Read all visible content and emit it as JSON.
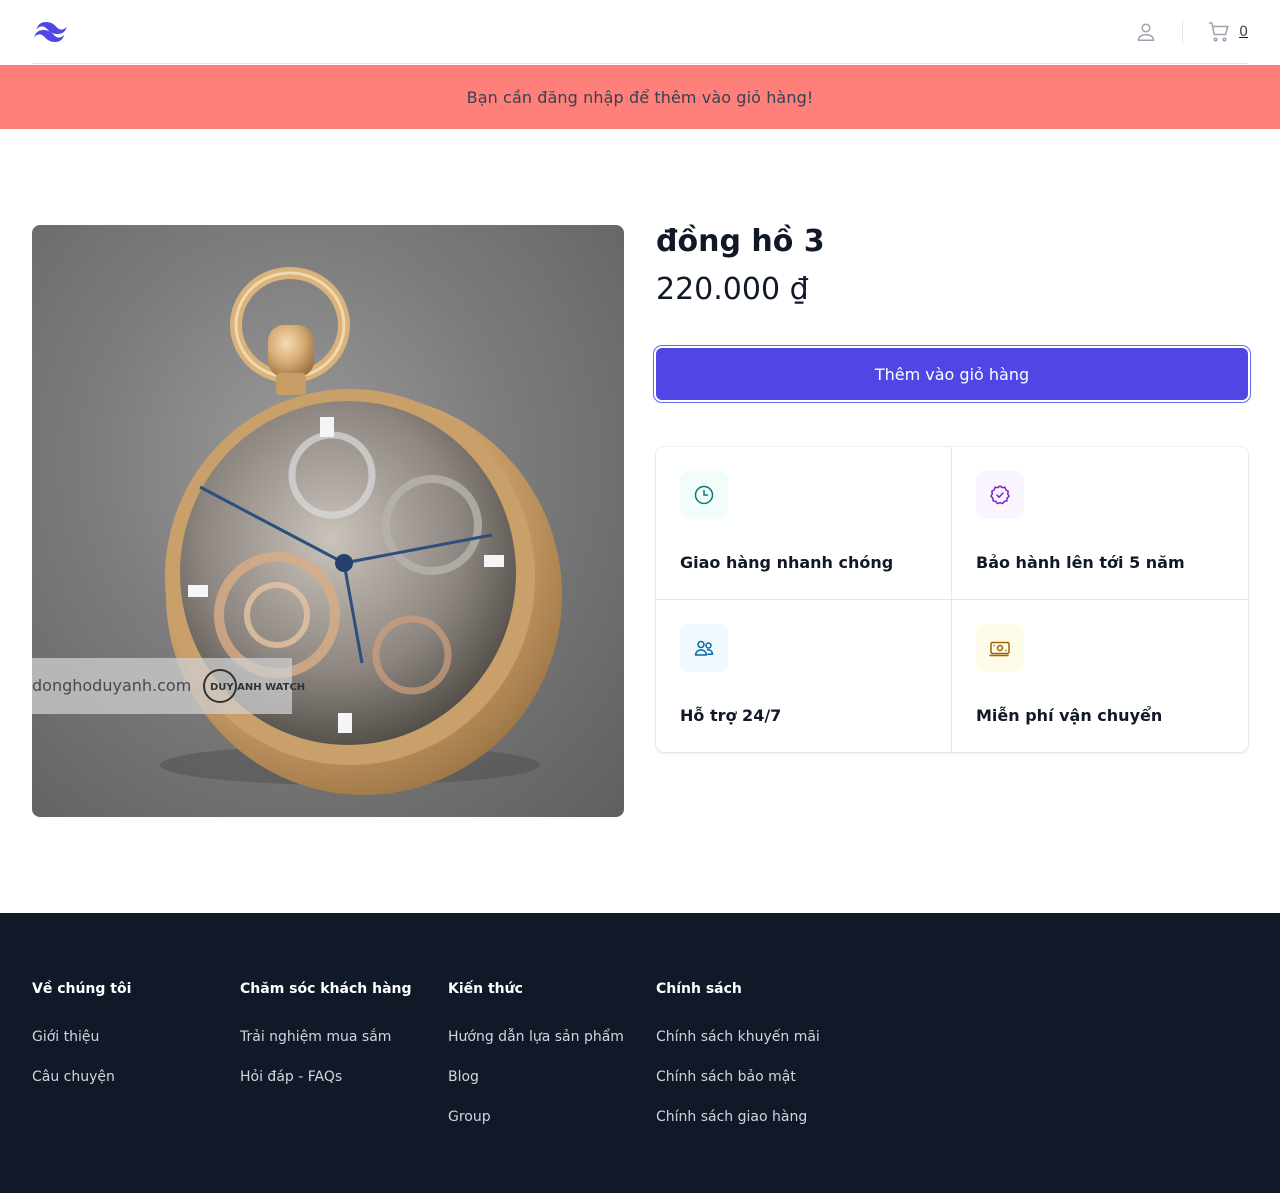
{
  "header": {
    "logo": "tailwind-logo",
    "user_icon": "user-icon",
    "cart_icon": "shopping-cart-icon",
    "cart_count": "0"
  },
  "alert": {
    "message": "Bạn cần đăng nhập để thêm vào giỏ hàng!",
    "color": "#ff807a"
  },
  "product": {
    "name": "đồng hồ 3",
    "price": "220.000 ₫",
    "add_to_cart_label": "Thêm vào giỏ hàng",
    "image_alt": "pocket-watch-image",
    "watermark_text": "donghoduyanh.com",
    "watermark_logo": "DUY ANH WATCH"
  },
  "features": [
    {
      "icon": "clock-icon",
      "label": "Giao hàng nhanh chóng",
      "accent": "#0f766e",
      "bg": "#f0fdfa"
    },
    {
      "icon": "badge-check-icon",
      "label": "Bảo hành lên tới 5 năm",
      "accent": "#7e22ce",
      "bg": "#faf5ff"
    },
    {
      "icon": "users-icon",
      "label": "Hỗ trợ 24/7",
      "accent": "#0369a1",
      "bg": "#f0f9ff"
    },
    {
      "icon": "cash-icon",
      "label": "Miễn phí vận chuyển",
      "accent": "#a16207",
      "bg": "#fefce8"
    }
  ],
  "footer": {
    "columns": [
      {
        "heading": "Về chúng tôi",
        "links": [
          "Giới thiệu",
          "Câu chuyện"
        ]
      },
      {
        "heading": "Chăm sóc khách hàng",
        "links": [
          "Trải nghiệm mua sắm",
          "Hỏi đáp - FAQs"
        ]
      },
      {
        "heading": "Kiến thức",
        "links": [
          "Hướng dẫn lựa sản phẩm",
          "Blog",
          "Group"
        ]
      },
      {
        "heading": "Chính sách",
        "links": [
          "Chính sách khuyến mãi",
          "Chính sách bảo mật",
          "Chính sách giao hàng"
        ]
      }
    ]
  },
  "colors": {
    "brand": "#4f46e5",
    "footer_bg": "#111827"
  }
}
